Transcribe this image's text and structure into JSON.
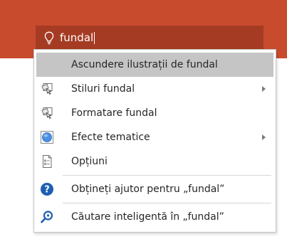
{
  "search": {
    "query": "fundal",
    "icon": "lightbulb-icon"
  },
  "menu": {
    "items": [
      {
        "label": "Ascundere ilustrații de fundal"
      },
      {
        "label": "Stiluri fundal",
        "icon": "background-styles-icon",
        "submenu": true
      },
      {
        "label": "Formatare fundal",
        "icon": "format-background-icon"
      },
      {
        "label": "Efecte tematice",
        "icon": "theme-effects-icon",
        "submenu": true
      },
      {
        "label": "Opțiuni",
        "icon": "options-icon"
      },
      {
        "label": "Obțineți ajutor pentru „fundal”",
        "icon": "help-icon"
      },
      {
        "label": "Căutare inteligentă în „fundal”",
        "icon": "smart-lookup-icon"
      }
    ]
  },
  "colors": {
    "ribbon": "#c84b2e",
    "search_box": "#a53b23",
    "highlight": "#c5c5c5",
    "accent_blue": "#1e5fb3"
  }
}
